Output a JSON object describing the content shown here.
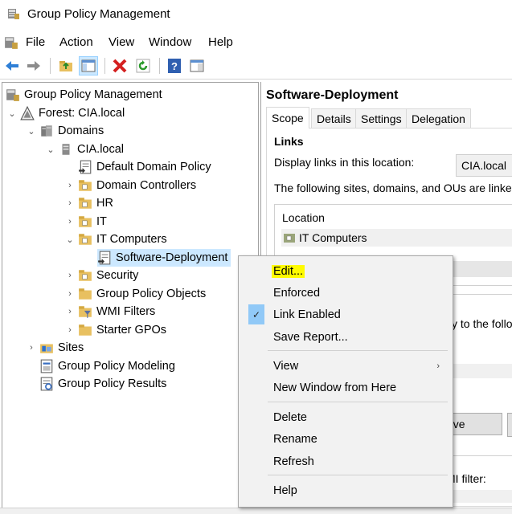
{
  "window": {
    "title": "Group Policy Management",
    "icon": "gpm-app-icon"
  },
  "menu": [
    "File",
    "Action",
    "View",
    "Window",
    "Help"
  ],
  "toolbar": {
    "buttons": [
      "back-arrow-icon",
      "forward-arrow-icon",
      "up-folder-icon",
      "show-hide-tree-icon",
      "delete-icon",
      "refresh-icon",
      "help-icon",
      "show-action-pane-icon"
    ]
  },
  "tree": {
    "root": "Group Policy Management",
    "forest": "Forest: CIA.local",
    "domains": "Domains",
    "domain": "CIA.local",
    "items": [
      "Default Domain Policy",
      "Domain Controllers",
      "HR",
      "IT",
      "IT Computers",
      "Software-Deployment",
      "Security",
      "Group Policy Objects",
      "WMI Filters",
      "Starter GPOs"
    ],
    "sites": "Sites",
    "modeling": "Group Policy Modeling",
    "results": "Group Policy Results"
  },
  "right": {
    "title": "Software-Deployment",
    "tabs": [
      "Scope",
      "Details",
      "Settings",
      "Delegation"
    ],
    "links_header": "Links",
    "display_links_label": "Display links in this location:",
    "location_value": "CIA.local",
    "linked_text": "The following sites, domains, and OUs are linked to",
    "location_col": "Location",
    "location_row": "IT Computers",
    "apply_text_fragment": "y to the follo",
    "remove_fragment": "ove",
    "wmi_fragment": "MI filter:"
  },
  "context_menu": {
    "items": [
      "Edit...",
      "Enforced",
      "Link Enabled",
      "Save Report...",
      "View",
      "New Window from Here",
      "Delete",
      "Rename",
      "Refresh",
      "Help"
    ],
    "checked": "Link Enabled",
    "highlighted": "Edit...",
    "highlight_color": "#fffb00",
    "check_glyph": "✓",
    "submenu_glyph": "›"
  }
}
